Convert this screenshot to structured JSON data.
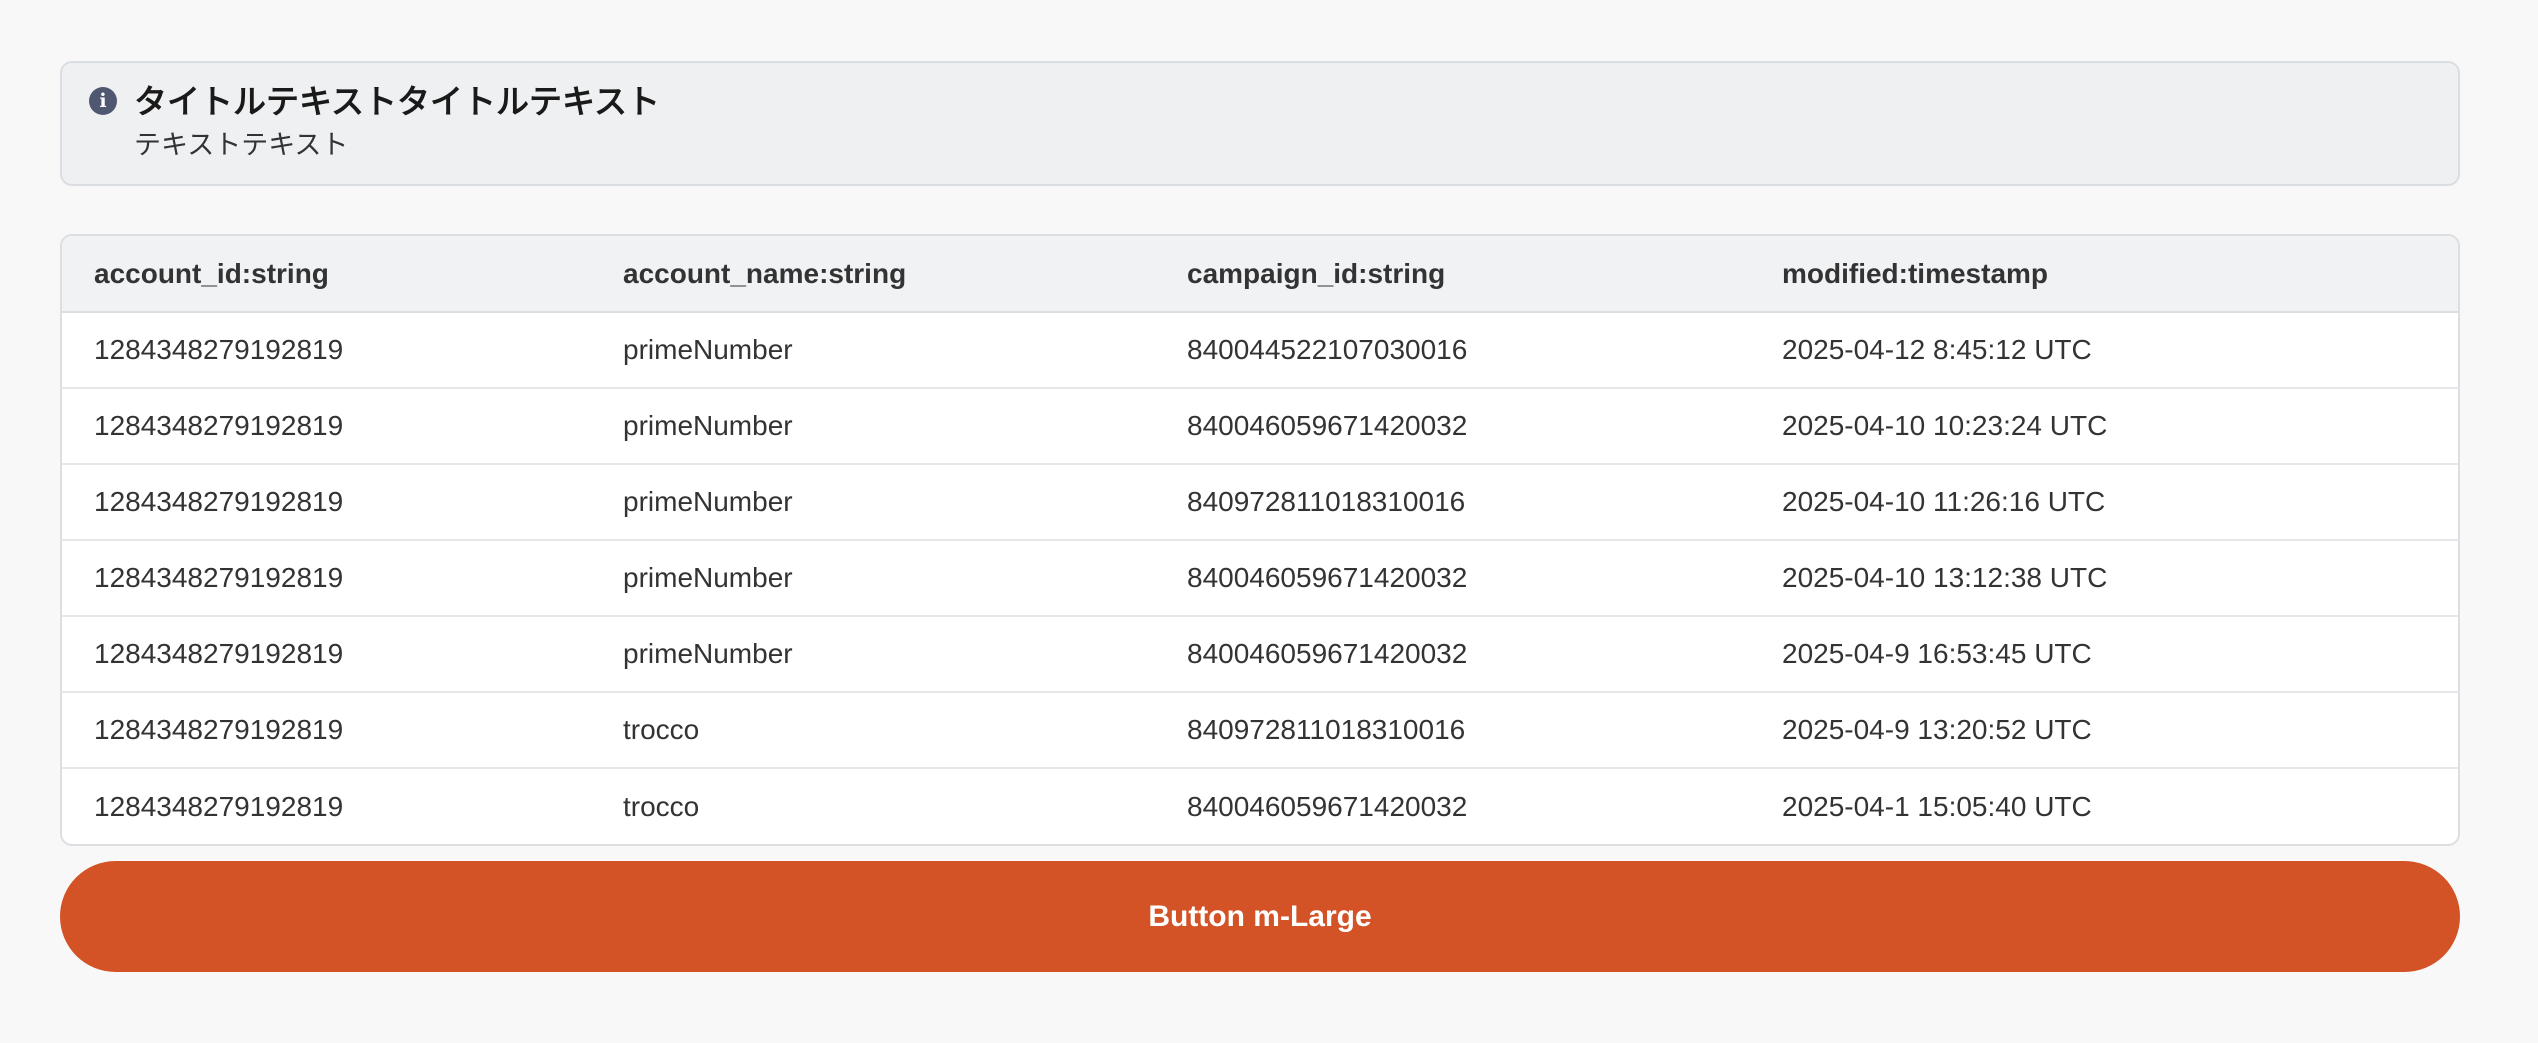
{
  "alert": {
    "icon": "info-icon",
    "icon_glyph": "i",
    "title": "タイトルテキストタイトルテキスト",
    "text": "テキストテキスト"
  },
  "table": {
    "headers": [
      "account_id:string",
      "account_name:string",
      "campaign_id:string",
      "modified:timestamp"
    ],
    "rows": [
      [
        "1284348279192819",
        "primeNumber",
        "840044522107030016",
        "2025-04-12 8:45:12 UTC"
      ],
      [
        "1284348279192819",
        "primeNumber",
        "840046059671420032",
        "2025-04-10 10:23:24 UTC"
      ],
      [
        "1284348279192819",
        "primeNumber",
        "840972811018310016",
        "2025-04-10 11:26:16 UTC"
      ],
      [
        "1284348279192819",
        "primeNumber",
        "840046059671420032",
        "2025-04-10 13:12:38 UTC"
      ],
      [
        "1284348279192819",
        "primeNumber",
        "840046059671420032",
        "2025-04-9 16:53:45 UTC"
      ],
      [
        "1284348279192819",
        "trocco",
        "840972811018310016",
        "2025-04-9 13:20:52 UTC"
      ],
      [
        "1284348279192819",
        "trocco",
        "840046059671420032",
        "2025-04-1 15:05:40 UTC"
      ]
    ]
  },
  "button": {
    "label": "Button m-Large"
  },
  "colors": {
    "button_bg": "#d35327",
    "alert_bg": "#eef0f2",
    "icon_bg": "#4f5870",
    "page_bg": "#f8f8f8"
  }
}
